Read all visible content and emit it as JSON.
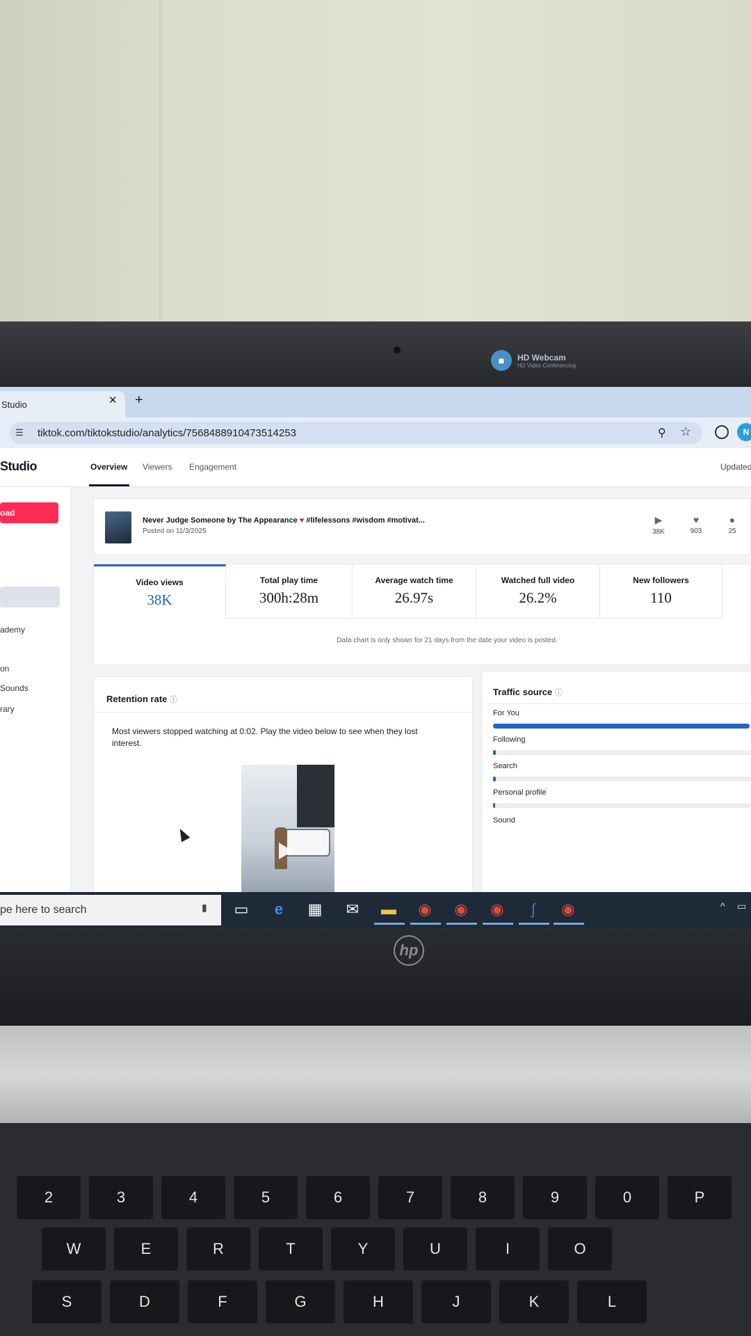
{
  "webcam_toast": {
    "title": "HD Webcam",
    "subtitle": "HD Video Conferencing"
  },
  "browser": {
    "tab_title": "Studio",
    "tab_close": "✕",
    "new_tab": "+",
    "url": "tiktok.com/tiktokstudio/analytics/7568488910473514253",
    "avatar_letter": "N"
  },
  "app": {
    "brand": "Studio",
    "tabs": [
      {
        "label": "Overview"
      },
      {
        "label": "Viewers"
      },
      {
        "label": "Engagement"
      }
    ],
    "updated_label": "Updated"
  },
  "sidebar": {
    "upload_label": "oad",
    "links": [
      {
        "label": "ademy"
      },
      {
        "label": "on"
      },
      {
        "label": "Sounds"
      },
      {
        "label": "rary"
      }
    ]
  },
  "video": {
    "title": "Never Judge Someone by The Appearance",
    "heart": "♥",
    "hashtags": "#lifelessons #wisdom #motivat...",
    "posted": "Posted on 11/3/2025",
    "stats": [
      {
        "icon": "play-icon",
        "value": "38K"
      },
      {
        "icon": "heart-icon",
        "value": "903"
      },
      {
        "icon": "comment-icon",
        "value": "25"
      }
    ]
  },
  "metrics": [
    {
      "label": "Video views",
      "value": "38K"
    },
    {
      "label": "Total play time",
      "value": "300h:28m"
    },
    {
      "label": "Average watch time",
      "value": "26.97s"
    },
    {
      "label": "Watched full video",
      "value": "26.2%"
    },
    {
      "label": "New followers",
      "value": "110"
    }
  ],
  "metrics_note": "Data chart is only shown for 21 days from the date your video is posted.",
  "retention": {
    "title": "Retention rate",
    "info": "ⓘ",
    "text": "Most viewers stopped watching at 0:02. Play the video below to see when they lost interest."
  },
  "traffic": {
    "title": "Traffic source",
    "info": "ⓘ",
    "sources": [
      {
        "label": "For You",
        "fill": 0.97
      },
      {
        "label": "Following",
        "fill": 0.01
      },
      {
        "label": "Search",
        "fill": 0.01
      },
      {
        "label": "Personal profile",
        "fill": 0.005
      },
      {
        "label": "Sound",
        "fill": 0
      }
    ]
  },
  "taskbar": {
    "search_placeholder": "pe here to search"
  },
  "keyboard": {
    "keys": [
      "2",
      "3",
      "4",
      "5",
      "6",
      "7",
      "8",
      "9",
      "0",
      "P",
      "W",
      "E",
      "R",
      "T",
      "Y",
      "U",
      "I",
      "O",
      "S",
      "D",
      "F",
      "G",
      "H",
      "J",
      "K",
      "L"
    ]
  },
  "colors": {
    "accent": "#1e66c8",
    "brand_red": "#fe2c55"
  }
}
